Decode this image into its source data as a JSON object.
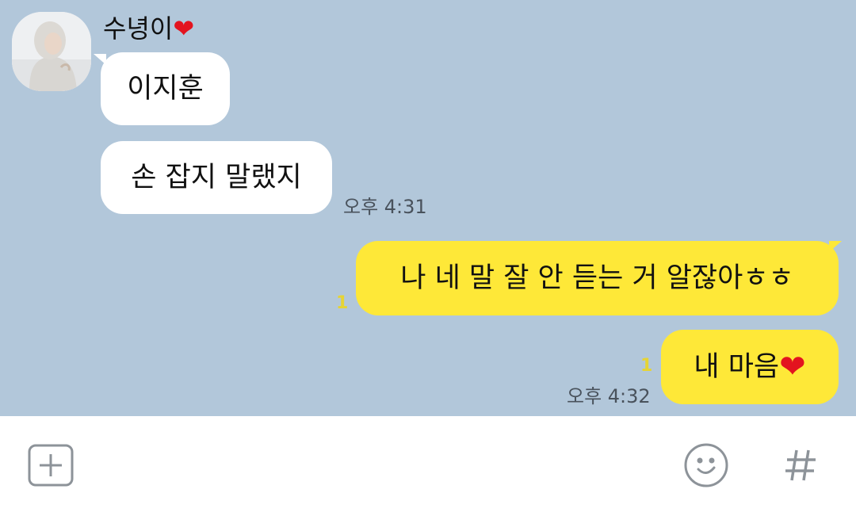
{
  "chat": {
    "sender_name": "수녕이",
    "messages_in": [
      {
        "text": "이지훈"
      },
      {
        "text": "손 잡지 말랬지",
        "time": "오후 4:31"
      }
    ],
    "messages_out": [
      {
        "text": "나 네 말 잘 안 듣는 거 알잖아ㅎㅎ",
        "unread": "1"
      },
      {
        "text": "내 마음",
        "unread": "1",
        "time": "오후 4:32"
      }
    ]
  },
  "input_bar": {
    "icons": [
      "plus-icon",
      "emoticon-icon",
      "hashtag-icon"
    ]
  },
  "colors": {
    "background": "#b2c7da",
    "incoming_bubble": "#ffffff",
    "outgoing_bubble": "#fee838",
    "unread": "#e6d435",
    "heart": "#e3141f"
  }
}
